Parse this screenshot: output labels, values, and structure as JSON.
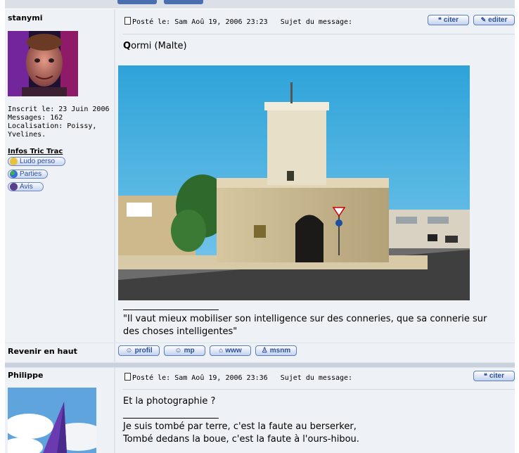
{
  "post1": {
    "username": "stanymi",
    "joined": "Inscrit le: 23 Juin 2006",
    "messages": "Messages: 162",
    "location": "Localisation: Poissy, Yvelines.",
    "infos_label": "Infos Tric Trac",
    "links": [
      "Ludo perso",
      "Parties",
      "Avis"
    ],
    "posted": "Posté le: Sam Aoû 19, 2006 23:23",
    "subject_label": "Sujet du message:",
    "quote_btn": "citer",
    "edit_btn": "editer",
    "title_first": "Q",
    "title_rest": "ormi (Malte)",
    "signature": "\"Il vaut mieux mobiliser son intelligence sur des conneries, que sa connerie sur des choses intelligentes\""
  },
  "footer": {
    "back_to_top": "Revenir en haut",
    "buttons": [
      "profil",
      "mp",
      "www",
      "msnm"
    ]
  },
  "post2": {
    "username": "Philippe",
    "posted": "Posté le: Sam Aoû 19, 2006 23:36",
    "subject_label": "Sujet du message:",
    "quote_btn": "citer",
    "body": "Et la photographie ?",
    "sig1": "Je suis tombé par terre, c'est la faute au berserker,",
    "sig2": "Tombé dedans la boue, c'est la faute à l'ours-hibou."
  },
  "colors": {
    "accent": "#2c4f9a",
    "panel": "#eef1f5",
    "separator": "#c9d1dc"
  },
  "icons": {
    "doc": "post-doc-icon",
    "quote": "quote-icon",
    "edit": "edit-icon",
    "www": "house-icon",
    "profile": "person-icon"
  }
}
